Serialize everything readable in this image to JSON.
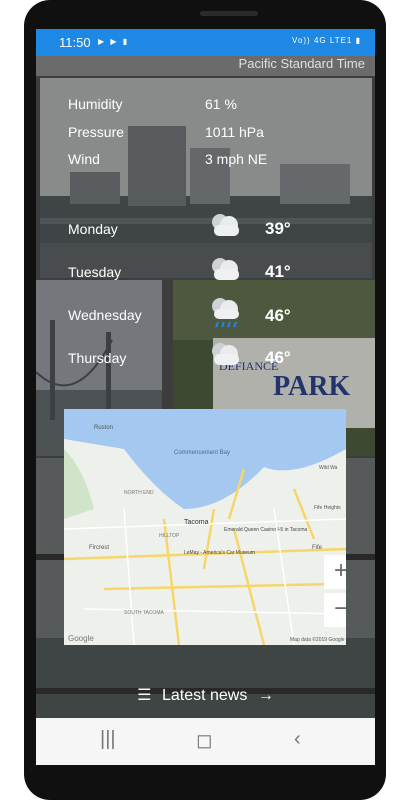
{
  "status_bar": {
    "time": "11:50",
    "left_icons": [
      "youtube-icon",
      "youtube-icon",
      "battery-saver-icon"
    ],
    "right_text": "Vo)) 4G LTE1"
  },
  "header": {
    "timezone": "Pacific Standard Time"
  },
  "conditions": [
    {
      "label": "Humidity",
      "value": "61 %"
    },
    {
      "label": "Pressure",
      "value": "1011 hPa"
    },
    {
      "label": "Wind",
      "value": "3 mph NE"
    }
  ],
  "forecast": [
    {
      "day": "Monday",
      "temp": "39°",
      "icon": "cloudy-icon"
    },
    {
      "day": "Tuesday",
      "temp": "41°",
      "icon": "cloudy-icon"
    },
    {
      "day": "Wednesday",
      "temp": "46°",
      "icon": "rain-icon"
    },
    {
      "day": "Thursday",
      "temp": "46°",
      "icon": "cloudy-icon"
    }
  ],
  "map": {
    "labels": [
      "Ruston",
      "Commencement Bay",
      "NORTH END",
      "Tacoma",
      "Emerald Queen Casino I-5 in Tacoma",
      "HILLTOP",
      "LeMay - America's Car Museum",
      "Fircrest",
      "SOUTH TACOMA",
      "Fife",
      "Fife Heights",
      "Wild Wa",
      "Tacoma"
    ],
    "zoom_in": "+",
    "zoom_out": "−",
    "google": "Google",
    "attribution": "Map data ©2019 Google"
  },
  "news_label": "Latest news",
  "colors": {
    "status_bar": "#1e88e5",
    "navbar": "#f6f6f6"
  }
}
